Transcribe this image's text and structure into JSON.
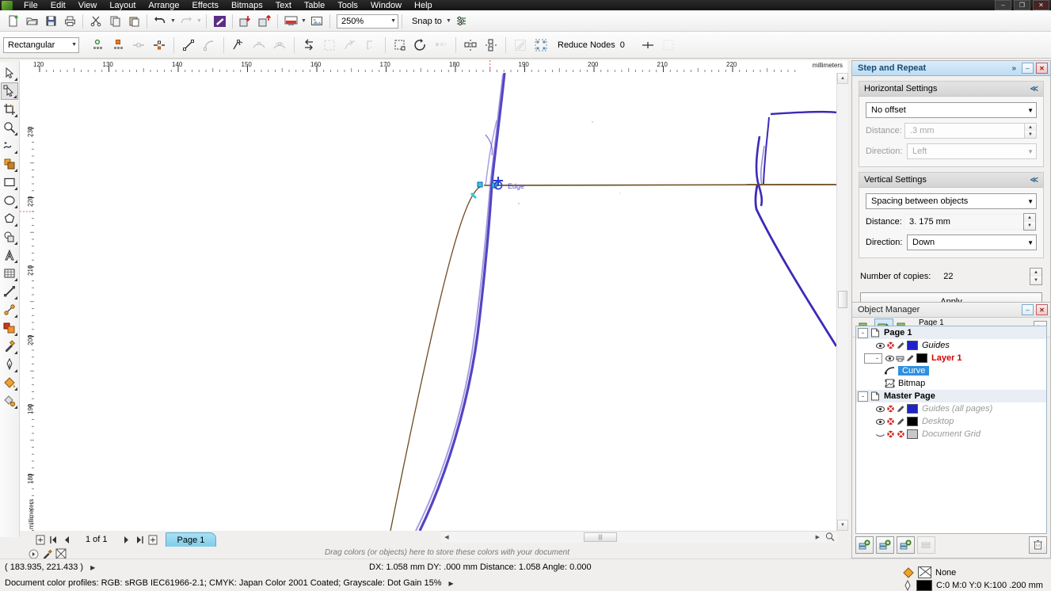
{
  "window": {
    "minimize_label": "–",
    "maximize_label": "❐",
    "close_label": "✕"
  },
  "menubar": {
    "items": [
      {
        "label": "File"
      },
      {
        "label": "Edit"
      },
      {
        "label": "View"
      },
      {
        "label": "Layout"
      },
      {
        "label": "Arrange"
      },
      {
        "label": "Effects"
      },
      {
        "label": "Bitmaps"
      },
      {
        "label": "Text"
      },
      {
        "label": "Table"
      },
      {
        "label": "Tools"
      },
      {
        "label": "Window"
      },
      {
        "label": "Help"
      }
    ]
  },
  "standard_toolbar": {
    "zoom_level": "250%",
    "snap_to_label": "Snap to",
    "buttons": [
      {
        "name": "new-document",
        "icon": "new-doc-icon"
      },
      {
        "name": "open-document",
        "icon": "folder-open-icon"
      },
      {
        "name": "save-document",
        "icon": "floppy-save-icon"
      },
      {
        "name": "print",
        "icon": "printer-icon"
      },
      {
        "name": "cut",
        "icon": "scissors-icon"
      },
      {
        "name": "copy",
        "icon": "copy-icon"
      },
      {
        "name": "paste",
        "icon": "paste-icon"
      },
      {
        "name": "undo",
        "icon": "undo-arrow-icon"
      },
      {
        "name": "redo",
        "icon": "redo-arrow-icon"
      },
      {
        "name": "corel-connect",
        "icon": "corel-connect-icon"
      },
      {
        "name": "import",
        "icon": "import-icon"
      },
      {
        "name": "export",
        "icon": "export-icon"
      },
      {
        "name": "application-launcher",
        "icon": "launcher-icon"
      },
      {
        "name": "publish-to-pdf",
        "icon": "pdf-icon"
      }
    ]
  },
  "property_bar": {
    "selection_mode": "Rectangular",
    "reduce_nodes_label": "Reduce Nodes",
    "reduce_nodes_value": "0",
    "tools": [
      {
        "name": "add-node",
        "icon": "add-node-icon",
        "enabled": true
      },
      {
        "name": "delete-node",
        "icon": "delete-node-icon",
        "enabled": true
      },
      {
        "name": "join-two-nodes",
        "icon": "join-nodes-icon",
        "enabled": false
      },
      {
        "name": "break-curve",
        "icon": "break-curve-icon",
        "enabled": true
      },
      {
        "name": "convert-to-line",
        "icon": "to-line-icon",
        "enabled": true
      },
      {
        "name": "convert-to-curve",
        "icon": "to-curve-icon",
        "enabled": false
      },
      {
        "name": "make-node-cusp",
        "icon": "cusp-node-icon",
        "enabled": true
      },
      {
        "name": "make-node-smooth",
        "icon": "smooth-node-icon",
        "enabled": false
      },
      {
        "name": "make-node-symmetrical",
        "icon": "symmetric-node-icon",
        "enabled": false
      },
      {
        "name": "reverse-direction",
        "icon": "reverse-direction-icon",
        "enabled": true
      },
      {
        "name": "extend-curve-to-close",
        "icon": "extend-close-icon",
        "enabled": false
      },
      {
        "name": "extract-subpath",
        "icon": "extract-subpath-icon",
        "enabled": false
      },
      {
        "name": "auto-close-curve",
        "icon": "auto-close-icon",
        "enabled": false
      },
      {
        "name": "stretch-scale-nodes",
        "icon": "stretch-nodes-icon",
        "enabled": true
      },
      {
        "name": "rotate-skew-nodes",
        "icon": "rotate-nodes-icon",
        "enabled": true
      },
      {
        "name": "align-nodes",
        "icon": "align-nodes-icon",
        "enabled": false
      },
      {
        "name": "reflect-nodes-horizontally",
        "icon": "reflect-h-icon",
        "enabled": true
      },
      {
        "name": "reflect-nodes-vertically",
        "icon": "reflect-v-icon",
        "enabled": true
      },
      {
        "name": "elastic-mode",
        "icon": "elastic-mode-icon",
        "enabled": false
      },
      {
        "name": "select-all-nodes",
        "icon": "select-all-nodes-icon",
        "enabled": true
      },
      {
        "name": "curve-smoothness",
        "icon": "curve-smoothness-icon",
        "enabled": false
      }
    ]
  },
  "toolbox": {
    "tools": [
      {
        "name": "tool-pick-previous",
        "icon": "pick-arrow-icon",
        "selected": false
      },
      {
        "name": "tool-pick",
        "icon": "shape-node-arrow-icon",
        "selected": true
      },
      {
        "name": "tool-crop",
        "icon": "crop-icon",
        "selected": false
      },
      {
        "name": "tool-zoom",
        "icon": "magnifier-icon",
        "selected": false
      },
      {
        "name": "tool-freehand",
        "icon": "freehand-curve-icon",
        "selected": false
      },
      {
        "name": "tool-smart-fill",
        "icon": "smart-fill-icon",
        "selected": false
      },
      {
        "name": "tool-rectangle",
        "icon": "rectangle-icon",
        "selected": false
      },
      {
        "name": "tool-ellipse",
        "icon": "ellipse-icon",
        "selected": false
      },
      {
        "name": "tool-polygon",
        "icon": "polygon-icon",
        "selected": false
      },
      {
        "name": "tool-basic-shapes",
        "icon": "basic-shapes-icon",
        "selected": false
      },
      {
        "name": "tool-text",
        "icon": "text-a-icon",
        "selected": false
      },
      {
        "name": "tool-table",
        "icon": "table-grid-icon",
        "selected": false
      },
      {
        "name": "tool-dimension",
        "icon": "dimension-line-icon",
        "selected": false
      },
      {
        "name": "tool-connector",
        "icon": "connector-icon",
        "selected": false
      },
      {
        "name": "tool-blend",
        "icon": "blend-effect-icon",
        "selected": false
      },
      {
        "name": "tool-color-eyedropper",
        "icon": "eyedropper-icon",
        "selected": false
      },
      {
        "name": "tool-outline",
        "icon": "outline-pen-icon",
        "selected": false
      },
      {
        "name": "tool-fill",
        "icon": "fill-bucket-icon",
        "selected": false
      },
      {
        "name": "tool-interactive-fill",
        "icon": "interactive-fill-icon",
        "selected": false
      }
    ]
  },
  "rulers": {
    "unit_label": "millimeters",
    "horizontal_ticks": [
      "120",
      "130",
      "140",
      "150",
      "160",
      "170",
      "180",
      "190",
      "200",
      "210",
      "220"
    ],
    "vertical_ticks": [
      "230",
      "220",
      "210",
      "200",
      "190",
      "180"
    ]
  },
  "canvas": {
    "snap_hint": "Edge"
  },
  "page_nav": {
    "add_page_before_label": "⊞",
    "first_label": "⏮",
    "prev_label": "◀",
    "counter": "1 of 1",
    "next_label": "▶",
    "last_label": "⏭",
    "add_page_after_label": "⊞",
    "page_tab": "Page 1"
  },
  "palette_hint": "Drag colors (or objects) here to store these colors with your document",
  "step_and_repeat": {
    "title": "Step and Repeat",
    "horizontal": {
      "group_title": "Horizontal Settings",
      "mode": "No offset",
      "distance_label": "Distance:",
      "distance_value": ".3 mm",
      "direction_label": "Direction:",
      "direction_value": "Left"
    },
    "vertical": {
      "group_title": "Vertical Settings",
      "mode": "Spacing between objects",
      "distance_label": "Distance:",
      "distance_value": "3. 175 mm",
      "direction_label": "Direction:",
      "direction_value": "Down"
    },
    "copies_label": "Number of copies:",
    "copies_value": "22",
    "apply_label": "Apply"
  },
  "object_manager": {
    "title": "Object Manager",
    "page_line1": "Page 1",
    "page_line2": "Layer 1",
    "tree": [
      {
        "level": 0,
        "label": "Page 1",
        "kind": "page",
        "expander": "-",
        "bold": true
      },
      {
        "level": 1,
        "label": "Guides",
        "kind": "layer",
        "color": "#1e23c8",
        "italic": true
      },
      {
        "level": 1,
        "label": "Layer 1",
        "kind": "layer",
        "color": "#000000",
        "active": true,
        "expander": "-"
      },
      {
        "level": 2,
        "label": "Curve",
        "kind": "object",
        "selected": true,
        "icon": "curve-icon"
      },
      {
        "level": 2,
        "label": "Bitmap",
        "kind": "object",
        "selected": false,
        "icon": "bitmap-icon"
      },
      {
        "level": 0,
        "label": "Master Page",
        "kind": "page",
        "expander": "-",
        "bold": true
      },
      {
        "level": 1,
        "label": "Guides (all pages)",
        "kind": "layer",
        "color": "#1e23c8",
        "italic": true,
        "dim": true
      },
      {
        "level": 1,
        "label": "Desktop",
        "kind": "layer",
        "color": "#000000",
        "italic": true,
        "dim": true
      },
      {
        "level": 1,
        "label": "Document Grid",
        "kind": "layer",
        "color": "#c8c8c8",
        "italic": true,
        "dim": true
      }
    ],
    "bottom_buttons": [
      {
        "name": "new-layer",
        "icon": "new-layer-icon",
        "enabled": true
      },
      {
        "name": "new-master-layer-odd",
        "icon": "new-master-layer-icon",
        "enabled": true
      },
      {
        "name": "new-master-layer-all",
        "icon": "new-master-layer-all-icon",
        "enabled": true
      },
      {
        "name": "edit-across-layers",
        "icon": "edit-across-layers-icon",
        "enabled": false
      },
      {
        "name": "delete-layer",
        "icon": "trash-icon",
        "enabled": true
      }
    ]
  },
  "status_bar": {
    "cursor_position": "( 183.935, 221.433 )",
    "delta_info": "DX: 1.058 mm  DY: .000 mm  Distance:  1.058  Angle: 0.000",
    "color_profiles": "Document color profiles: RGB: sRGB IEC61966-2.1; CMYK: Japan Color 2001 Coated; Grayscale: Dot Gain 15%",
    "fill_label": "None",
    "outline_label": "C:0 M:0 Y:0 K:100  .200 mm",
    "outline_color": "#000000"
  },
  "color_palette": {
    "swatches": [
      "#000000",
      "#1a1a1a",
      "#333333",
      "#4d4d4d",
      "#666666",
      "#808080",
      "#999999",
      "#b3b3b3",
      "#cccccc",
      "#e6e6e6",
      "#ffffff",
      "#1b1bc8",
      "#00a0e9",
      "#00a650",
      "#fff200",
      "#ed1c24",
      "#ec008c",
      "#f7941e",
      "#f9b3b3",
      "#8c6239",
      "#c7b8e0",
      "#8f7fbf",
      "#6f5fa8",
      "#4a5e8c",
      "#2e4a7a",
      "#00aeef",
      "#7fd4f0",
      "#bfe6f5",
      "#8c9ea8",
      "#a8c8d8",
      "#d8e8f0"
    ]
  }
}
